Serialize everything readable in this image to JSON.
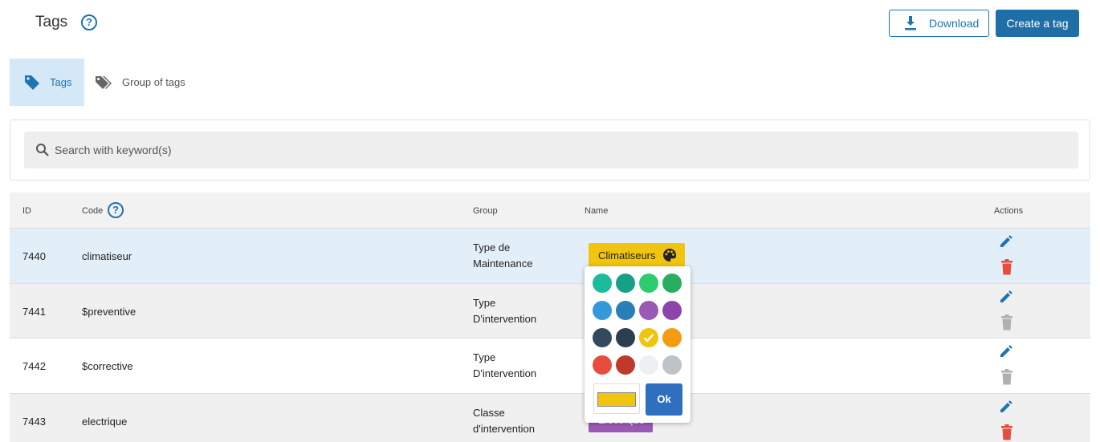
{
  "header": {
    "title": "Tags",
    "help": "?",
    "download_label": "Download",
    "create_label": "Create a tag"
  },
  "tabs": [
    {
      "label": "Tags",
      "active": true
    },
    {
      "label": "Group of tags",
      "active": false
    }
  ],
  "search": {
    "placeholder": "Search with keyword(s)",
    "value": ""
  },
  "table": {
    "columns": {
      "id": "ID",
      "code": "Code",
      "group": "Group",
      "name": "Name",
      "actions": "Actions"
    },
    "rows": [
      {
        "id": "7440",
        "code": "climatiseur",
        "group_line1": "Type de",
        "group_line2": "Maintenance",
        "name": "Climatiseurs",
        "name_color": "#f1c40f",
        "trash_color": "#e74c3c"
      },
      {
        "id": "7441",
        "code": "$preventive",
        "group_line1": "Type",
        "group_line2": "D'intervention",
        "name": "",
        "name_color": "",
        "trash_color": "#b0b0b0"
      },
      {
        "id": "7442",
        "code": "$corrective",
        "group_line1": "Type",
        "group_line2": "D'intervention",
        "name": "",
        "name_color": "",
        "trash_color": "#b0b0b0"
      },
      {
        "id": "7443",
        "code": "electrique",
        "group_line1": "Classe",
        "group_line2": "d'intervention",
        "name": "Electrique",
        "name_color": "#9b59b6",
        "trash_color": "#e74c3c"
      }
    ]
  },
  "color_picker": {
    "swatches": [
      [
        "#1abc9c",
        "#16a085",
        "#2ecc71",
        "#27ae60"
      ],
      [
        "#3498db",
        "#2980b9",
        "#9b59b6",
        "#8e44ad"
      ],
      [
        "#34495e",
        "#2c3e50",
        "#f1c40f",
        "#f39c12"
      ],
      [
        "#e74c3c",
        "#c0392b",
        "#ecf0f1",
        "#bdc3c7"
      ]
    ],
    "selected": "#f1c40f",
    "ok_label": "Ok"
  },
  "colors": {
    "accent": "#1e73b0",
    "primary_button": "#1e6fa8",
    "selected_row": "#e3eff8",
    "danger": "#e74c3c"
  }
}
